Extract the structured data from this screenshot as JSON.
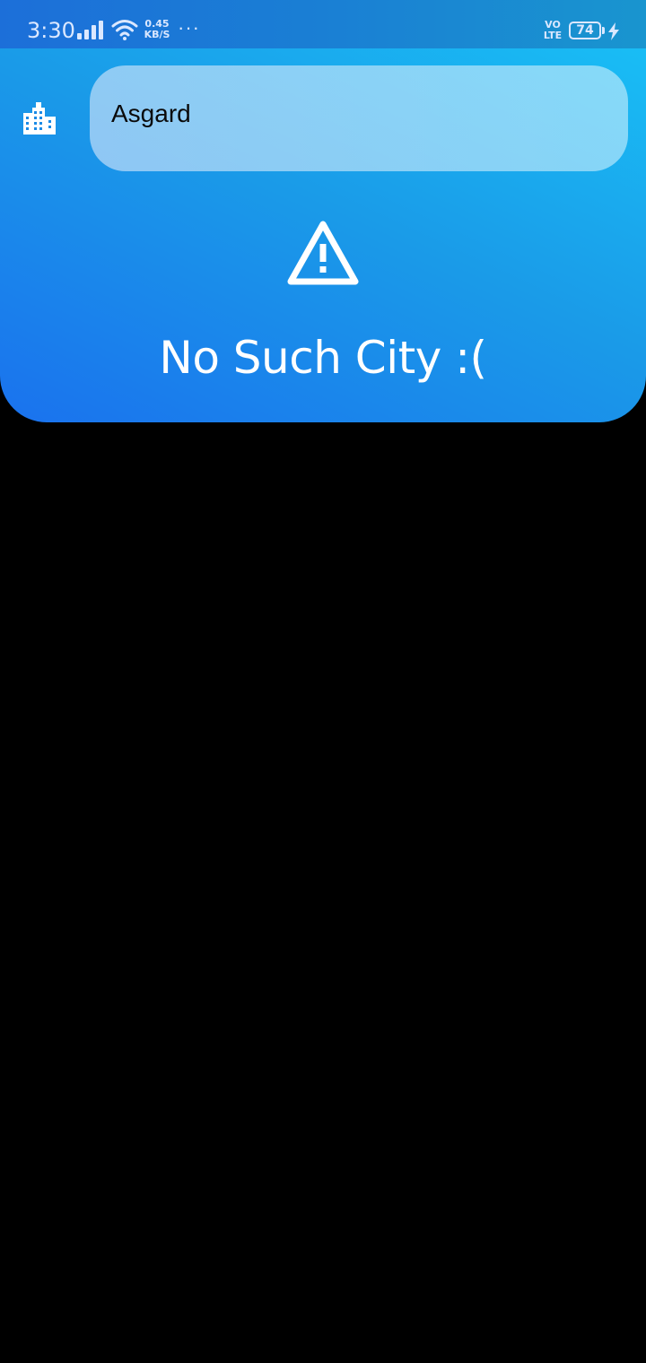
{
  "status_bar": {
    "time": "3:30",
    "network_speed_value": "0.45",
    "network_speed_unit": "KB/S",
    "more_indicator": "···",
    "volte_top": "VO",
    "volte_bottom": "LTE",
    "battery_level": "74",
    "icons": [
      "signal-icon",
      "wifi-icon",
      "charging-icon"
    ]
  },
  "search": {
    "value": "Asgard",
    "leading_icon": "city-icon"
  },
  "error": {
    "icon": "warning-icon",
    "message": "No Such City :("
  },
  "colors": {
    "gradient_start": "#1a72ee",
    "gradient_end": "#19bdf5",
    "background": "#000000",
    "message_text": "#ffffff"
  }
}
